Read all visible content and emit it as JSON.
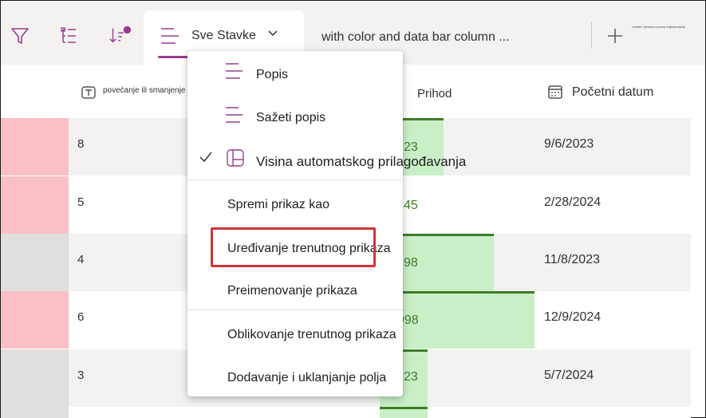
{
  "toolbar": {
    "active_view": "Sve Stavke",
    "other_view": "with color and data bar column ...",
    "tiny_note": "Uzmite i ljestvicu prema vrijednostima",
    "icons": [
      "filter-icon",
      "group-list-icon",
      "sort-icon",
      "list-view-icon",
      "chevron-down-icon",
      "add-icon"
    ],
    "accent_color": "#9b3d8f"
  },
  "columns": {
    "col1": "povećanje ili smanjenje broja decimalnim mjesta prilikom oblikovanja kao broja",
    "col2": "Prihod",
    "col3": "Početni datum"
  },
  "rows": [
    {
      "num": "8",
      "revenue": "23",
      "date": "9/6/2023",
      "bar_fraction": 0.15
    },
    {
      "num": "5",
      "revenue": "45",
      "date": "2/28/2024",
      "bar_fraction": 0.0
    },
    {
      "num": "4",
      "revenue": "98",
      "date": "11/8/2023",
      "bar_fraction": 0.27
    },
    {
      "num": "6",
      "revenue": "998",
      "date": "12/9/2024",
      "bar_fraction": 0.37
    },
    {
      "num": "3",
      "revenue": "23",
      "date": "5/7/2024",
      "bar_fraction": 0.11
    }
  ],
  "menu": {
    "items": {
      "list": "Popis",
      "compact_list": "Sažeti popis",
      "autofit_height": "Visina automatskog prilagođavanja",
      "save_view_as": "Spremi prikaz kao",
      "edit_current_view": "Uređivanje trenutnog prikaza",
      "rename_view": "Preimenovanje prikaza",
      "format_current_view": "Oblikovanje trenutnog prikaza",
      "add_remove_fields": "Dodavanje i uklanjanje polja"
    },
    "checked": "autofit_height"
  },
  "colors": {
    "pink_cell": "#fbc0c5",
    "bar_fill": "#c9efc7",
    "bar_stroke": "#3d7d27",
    "highlight": "#d13438"
  }
}
